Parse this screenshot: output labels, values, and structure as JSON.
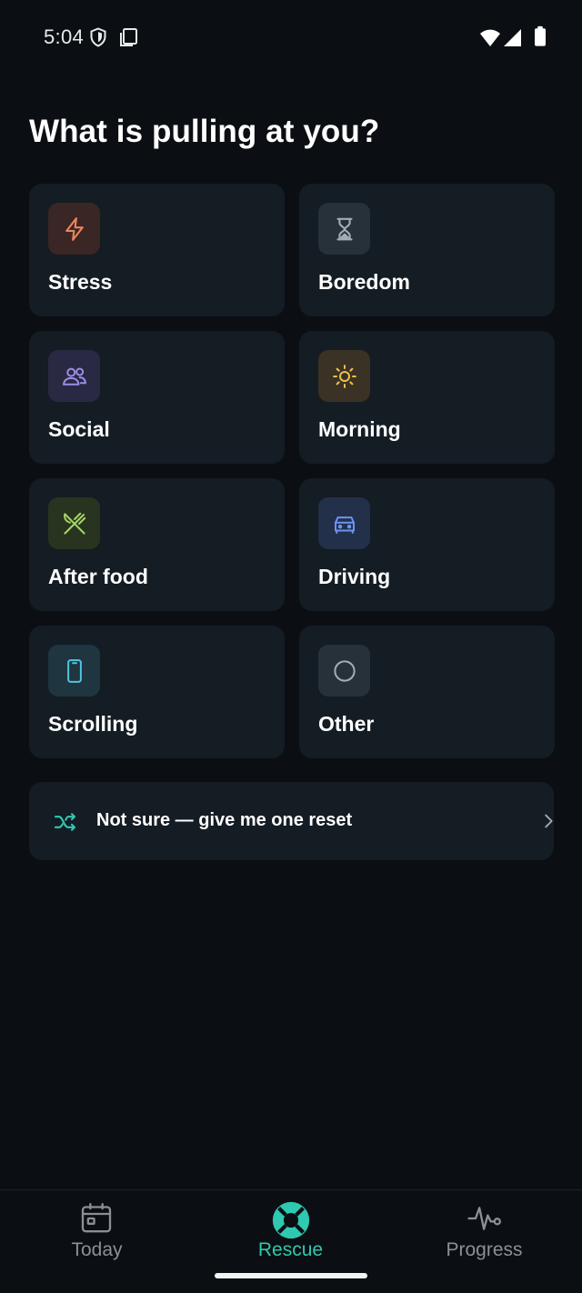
{
  "status_bar": {
    "time": "5:04"
  },
  "title": "What is pulling at you?",
  "triggers": [
    {
      "label": "Stress",
      "icon": "lightning-icon",
      "icon_color": "#e8855a",
      "box_color": "#3a2624"
    },
    {
      "label": "Boredom",
      "icon": "hourglass-icon",
      "icon_color": "#9aa3ab",
      "box_color": "#27313a"
    },
    {
      "label": "Social",
      "icon": "people-icon",
      "icon_color": "#9b8ee8",
      "box_color": "#2a2944"
    },
    {
      "label": "Morning",
      "icon": "sun-icon",
      "icon_color": "#f1c04a",
      "box_color": "#3a3224"
    },
    {
      "label": "After food",
      "icon": "utensils-icon",
      "icon_color": "#a6d36a",
      "box_color": "#28341f"
    },
    {
      "label": "Driving",
      "icon": "car-icon",
      "icon_color": "#6c94f0",
      "box_color": "#22304a"
    },
    {
      "label": "Scrolling",
      "icon": "phone-icon",
      "icon_color": "#52c3e0",
      "box_color": "#1f3540"
    },
    {
      "label": "Other",
      "icon": "circle-icon",
      "icon_color": "#9aa3ab",
      "box_color": "#27313a"
    }
  ],
  "reset": {
    "label": "Not sure — give me one reset",
    "accent": "#2ec9b0"
  },
  "nav": {
    "today": "Today",
    "rescue": "Rescue",
    "progress": "Progress",
    "active_color": "#2ec9b0",
    "inactive_color": "#8a9097"
  }
}
